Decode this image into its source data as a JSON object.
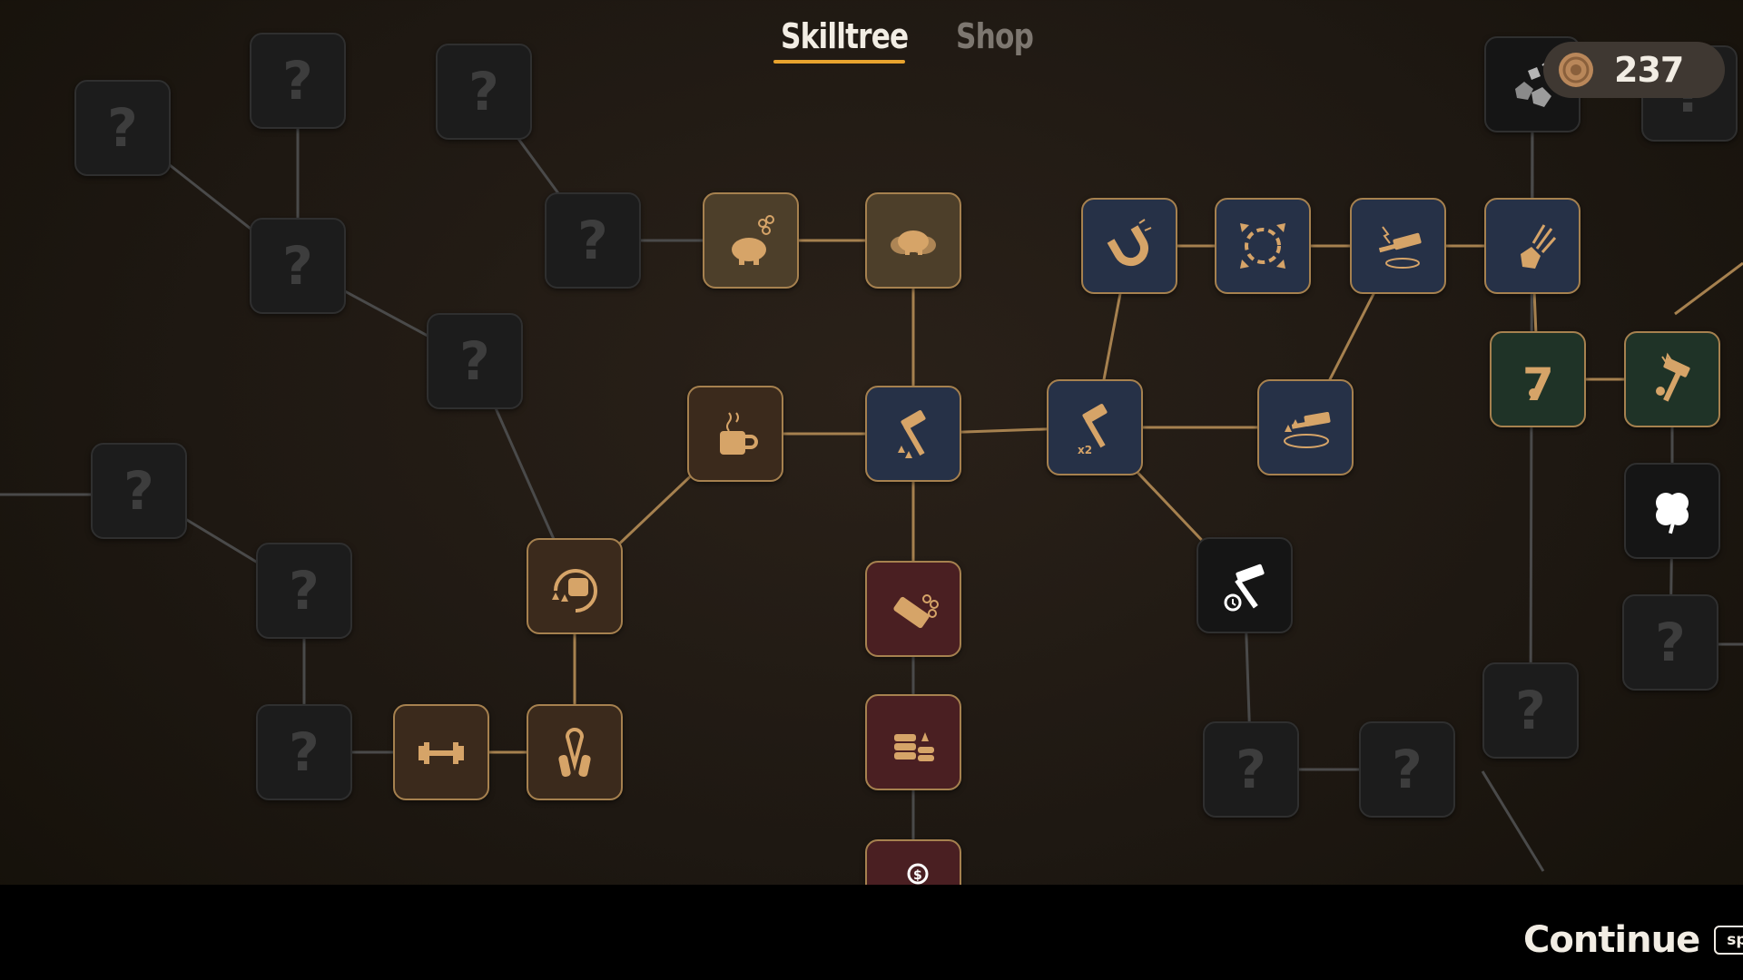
{
  "tabs": {
    "skilltree": "Skilltree",
    "shop": "Shop"
  },
  "coins": {
    "amount": "237"
  },
  "footer": {
    "continue_label": "Continue",
    "key_hint": "space"
  },
  "colors": {
    "accent": "#e8a32e",
    "active_link": "#a6814f",
    "locked_link": "#4a4a4a",
    "node_border": "#a6814f"
  },
  "nodes": [
    {
      "id": "L1",
      "kind": "locked",
      "icon": "question-mark"
    },
    {
      "id": "L2",
      "kind": "locked",
      "icon": "question-mark"
    },
    {
      "id": "L3",
      "kind": "locked",
      "icon": "question-mark"
    },
    {
      "id": "L4",
      "kind": "locked",
      "icon": "question-mark"
    },
    {
      "id": "L5",
      "kind": "locked",
      "icon": "question-mark"
    },
    {
      "id": "L6",
      "kind": "locked",
      "icon": "question-mark"
    },
    {
      "id": "L7",
      "kind": "locked",
      "icon": "question-mark"
    },
    {
      "id": "L8",
      "kind": "locked",
      "icon": "question-mark"
    },
    {
      "id": "L9",
      "kind": "locked",
      "icon": "question-mark"
    },
    {
      "id": "L10",
      "kind": "locked",
      "icon": "question-mark"
    },
    {
      "id": "L11",
      "kind": "locked",
      "icon": "question-mark"
    },
    {
      "id": "L12",
      "kind": "locked",
      "icon": "question-mark"
    },
    {
      "id": "L13",
      "kind": "locked",
      "icon": "question-mark"
    },
    {
      "id": "L14",
      "kind": "locked",
      "icon": "question-mark"
    },
    {
      "id": "piggy1",
      "kind": "gold",
      "icon": "piggy-bank-coins-icon"
    },
    {
      "id": "piggy2",
      "kind": "gold",
      "icon": "piggy-banks-icon"
    },
    {
      "id": "coffee",
      "kind": "brown",
      "icon": "coffee-cup-icon"
    },
    {
      "id": "fist",
      "kind": "brown",
      "icon": "power-fist-icon"
    },
    {
      "id": "dumbbell",
      "kind": "brown",
      "icon": "dumbbell-icon"
    },
    {
      "id": "grip",
      "kind": "brown",
      "icon": "hand-grip-icon"
    },
    {
      "id": "hammerup",
      "kind": "blue",
      "icon": "hammer-upgrade-icon"
    },
    {
      "id": "hammerx2",
      "kind": "blue",
      "icon": "double-hammer-icon"
    },
    {
      "id": "magnet",
      "kind": "blue",
      "icon": "magnet-icon"
    },
    {
      "id": "target",
      "kind": "blue",
      "icon": "area-target-icon"
    },
    {
      "id": "lightning",
      "kind": "blue",
      "icon": "lightning-hammer-icon"
    },
    {
      "id": "meteor",
      "kind": "blue",
      "icon": "meteor-rock-icon"
    },
    {
      "id": "shockwave",
      "kind": "blue",
      "icon": "hammer-shockwave-icon"
    },
    {
      "id": "bricks",
      "kind": "red",
      "icon": "gold-bars-icon"
    },
    {
      "id": "stacks",
      "kind": "red",
      "icon": "coin-stacks-icon"
    },
    {
      "id": "hand",
      "kind": "red",
      "icon": "hand-dollar-icon"
    },
    {
      "id": "seven",
      "kind": "green",
      "icon": "lucky-seven-icon"
    },
    {
      "id": "luckyhammer",
      "kind": "green",
      "icon": "lucky-hammer-icon"
    },
    {
      "id": "clover",
      "kind": "dark",
      "icon": "clover-icon"
    },
    {
      "id": "timerhammer",
      "kind": "dark",
      "icon": "timer-hammer-icon"
    },
    {
      "id": "rocks",
      "kind": "dark",
      "icon": "rubble-icon"
    }
  ],
  "links": [
    {
      "from": "L1",
      "to": "L3",
      "state": "locked"
    },
    {
      "from": "L2",
      "to": "L3",
      "state": "locked"
    },
    {
      "from": "L3",
      "to": "L4",
      "state": "locked"
    },
    {
      "from": "L4",
      "to": "fist",
      "state": "locked"
    },
    {
      "from": "L5",
      "to": "L6",
      "state": "locked"
    },
    {
      "from": "L6",
      "to": "L7",
      "state": "locked"
    },
    {
      "from": "L7",
      "to": "dumbbell",
      "state": "locked"
    },
    {
      "from": "L8",
      "to": "L9",
      "state": "locked"
    },
    {
      "from": "L9",
      "to": "piggy1",
      "state": "locked"
    },
    {
      "from": "piggy1",
      "to": "piggy2",
      "state": "active"
    },
    {
      "from": "piggy2",
      "to": "hammerup",
      "state": "active"
    },
    {
      "from": "coffee",
      "to": "hammerup",
      "state": "active"
    },
    {
      "from": "fist",
      "to": "coffee",
      "state": "active"
    },
    {
      "from": "fist",
      "to": "grip",
      "state": "active"
    },
    {
      "from": "dumbbell",
      "to": "grip",
      "state": "active"
    },
    {
      "from": "hammerup",
      "to": "bricks",
      "state": "active"
    },
    {
      "from": "bricks",
      "to": "stacks",
      "state": "locked"
    },
    {
      "from": "stacks",
      "to": "hand",
      "state": "locked"
    },
    {
      "from": "hammerup",
      "to": "hammerx2",
      "state": "active"
    },
    {
      "from": "hammerx2",
      "to": "magnet",
      "state": "active"
    },
    {
      "from": "hammerx2",
      "to": "shockwave",
      "state": "active"
    },
    {
      "from": "hammerx2",
      "to": "timerhammer",
      "state": "active"
    },
    {
      "from": "magnet",
      "to": "target",
      "state": "active"
    },
    {
      "from": "target",
      "to": "lightning",
      "state": "active"
    },
    {
      "from": "lightning",
      "to": "meteor",
      "state": "active"
    },
    {
      "from": "shockwave",
      "to": "lightning",
      "state": "active"
    },
    {
      "from": "meteor",
      "to": "rocks",
      "state": "locked"
    },
    {
      "from": "meteor",
      "to": "seven",
      "state": "active"
    },
    {
      "from": "seven",
      "to": "luckyhammer",
      "state": "active"
    },
    {
      "from": "luckyhammer",
      "to": "clover",
      "state": "locked"
    },
    {
      "from": "clover",
      "to": "L12",
      "state": "locked"
    },
    {
      "from": "timerhammer",
      "to": "L10",
      "state": "locked"
    },
    {
      "from": "L10",
      "to": "L11",
      "state": "locked"
    },
    {
      "from": "rocks",
      "to": "L14",
      "state": "locked"
    }
  ]
}
